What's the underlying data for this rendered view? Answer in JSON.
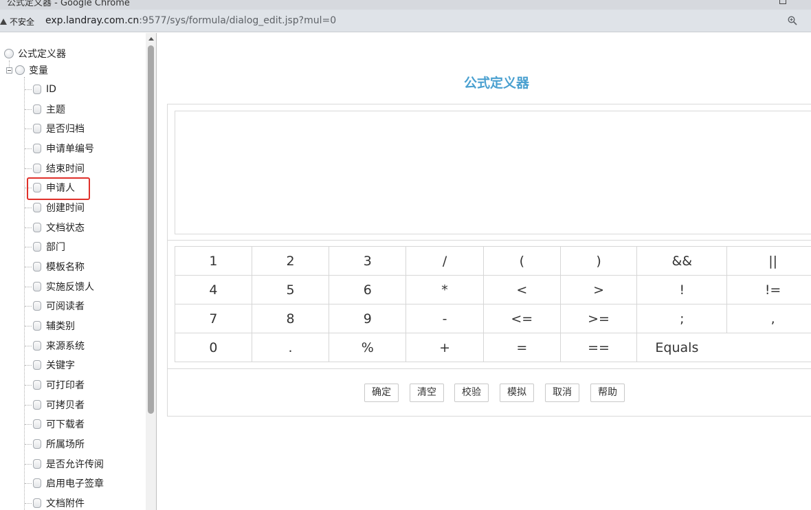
{
  "browser": {
    "window_title": "公式定义器 - Google Chrome",
    "security_label": "不安全",
    "url_host": "exp.landray.com.cn",
    "url_path": ":9577/sys/formula/dialog_edit.jsp?mul=0"
  },
  "tree": {
    "root_label": "公式定义器",
    "group_label": "变量",
    "items": [
      "ID",
      "主题",
      "是否归档",
      "申请单编号",
      "结束时间",
      "申请人",
      "创建时间",
      "文档状态",
      "部门",
      "模板名称",
      "实施反馈人",
      "可阅读者",
      "辅类别",
      "来源系统",
      "关键字",
      "可打印者",
      "可拷贝者",
      "可下载者",
      "所属场所",
      "是否允许传阅",
      "启用电子签章",
      "文档附件"
    ],
    "highlighted_item": "申请人"
  },
  "main": {
    "title": "公式定义器",
    "keypad": [
      [
        "1",
        "2",
        "3",
        "/",
        "(",
        ")",
        "&&",
        "||"
      ],
      [
        "4",
        "5",
        "6",
        "*",
        "<",
        ">",
        "!",
        "!="
      ],
      [
        "7",
        "8",
        "9",
        "-",
        "<=",
        ">=",
        ";",
        ","
      ],
      [
        "0",
        ".",
        "%",
        "+",
        "=",
        "==",
        "Equals"
      ]
    ],
    "buttons": {
      "confirm": "确定",
      "clear": "清空",
      "validate": "校验",
      "simulate": "模拟",
      "cancel": "取消",
      "help": "帮助"
    }
  },
  "colors": {
    "title_accent": "#4aa0d0",
    "highlight_border": "#e0302a"
  }
}
